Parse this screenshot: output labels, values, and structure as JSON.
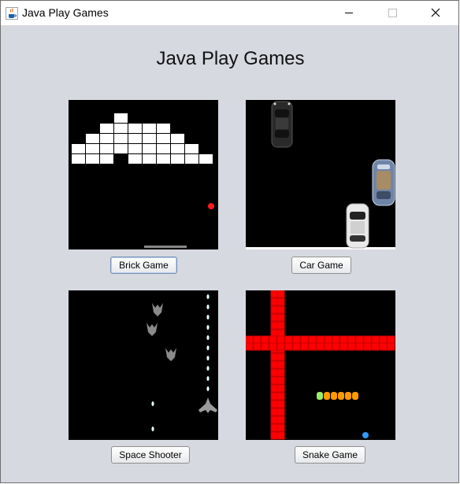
{
  "window": {
    "title": "Java Play Games",
    "icon": "java-coffee-cup-icon",
    "controls": [
      "minimize-icon",
      "maximize-icon",
      "close-icon"
    ]
  },
  "main": {
    "heading": "Java Play Games",
    "games": [
      {
        "button_label": "Brick Game",
        "preview": "brick-breaker-preview",
        "focused": true
      },
      {
        "button_label": "Car Game",
        "preview": "car-racing-preview",
        "focused": false
      },
      {
        "button_label": "Space Shooter",
        "preview": "space-shooter-preview",
        "focused": false
      },
      {
        "button_label": "Snake Game",
        "preview": "snake-preview",
        "focused": false
      }
    ]
  },
  "colors": {
    "window_bg": "#d6d9df",
    "preview_bg": "#000000",
    "brick": "#ffffff",
    "ball": "#ff0000",
    "snake_wall": "#ff0000",
    "snake_body": "#ff9900",
    "snake_head": "#99ee66",
    "food": "#3399ff"
  }
}
